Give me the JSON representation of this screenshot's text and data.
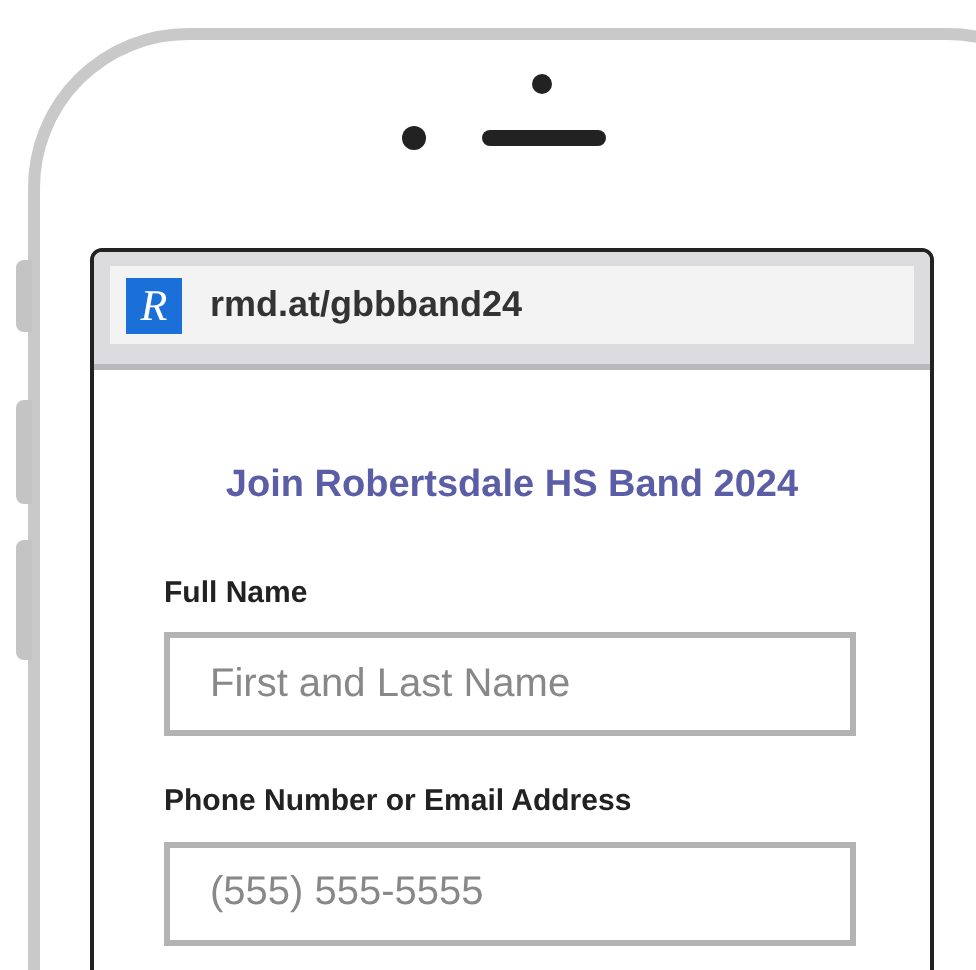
{
  "browser": {
    "logo_letter": "R",
    "url": "rmd.at/gbbband24"
  },
  "form": {
    "title": "Join Robertsdale HS Band 2024",
    "fields": [
      {
        "label": "Full Name",
        "placeholder": "First and Last Name"
      },
      {
        "label": "Phone Number or Email Address",
        "placeholder": "(555) 555-5555"
      }
    ]
  }
}
